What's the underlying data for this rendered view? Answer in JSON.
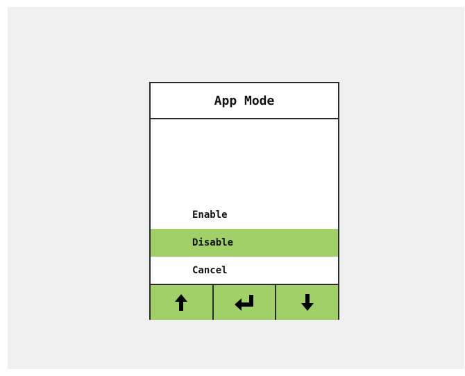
{
  "dialog": {
    "title": "App Mode"
  },
  "menu": {
    "items": [
      {
        "label": "Enable",
        "selected": false
      },
      {
        "label": "Disable",
        "selected": true
      },
      {
        "label": "Cancel",
        "selected": false
      }
    ]
  },
  "buttons": [
    {
      "icon": "arrow-up-icon"
    },
    {
      "icon": "enter-icon"
    },
    {
      "icon": "arrow-down-icon"
    }
  ],
  "colors": {
    "background": "#f0f0f0",
    "highlight": "#a1d068",
    "border": "#2a2a2a"
  }
}
